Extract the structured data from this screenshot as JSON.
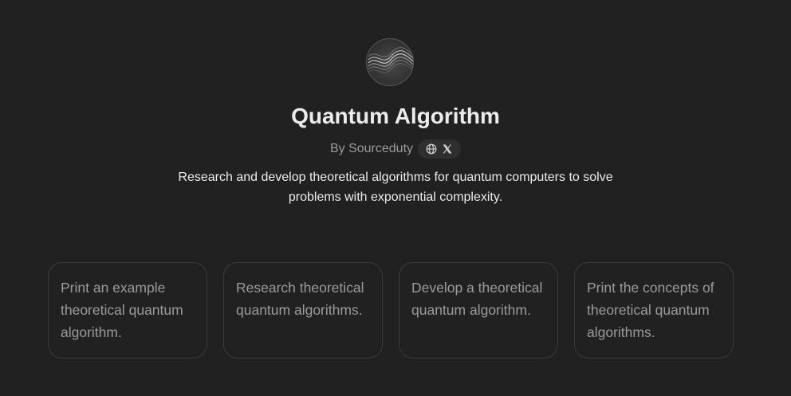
{
  "gpt": {
    "title": "Quantum Algorithm",
    "byline": "By Sourceduty",
    "description": "Research and develop theoretical algorithms for quantum computers to solve problems with exponential complexity.",
    "avatar_icon": "quantum-wave-avatar",
    "social_links": [
      {
        "icon": "globe-icon"
      },
      {
        "icon": "x-logo-icon"
      }
    ]
  },
  "conversation_starters": [
    {
      "text": "Print an example theoretical quantum algorithm."
    },
    {
      "text": "Research theoretical quantum algorithms."
    },
    {
      "text": "Develop a theoretical quantum algorithm."
    },
    {
      "text": "Print the concepts of theoretical quantum algorithms."
    }
  ],
  "colors": {
    "background": "#212121",
    "title": "#ececec",
    "muted_text": "#9b9b9b",
    "card_border": "#3b3b3b",
    "pill_background": "#2f2f2f"
  }
}
